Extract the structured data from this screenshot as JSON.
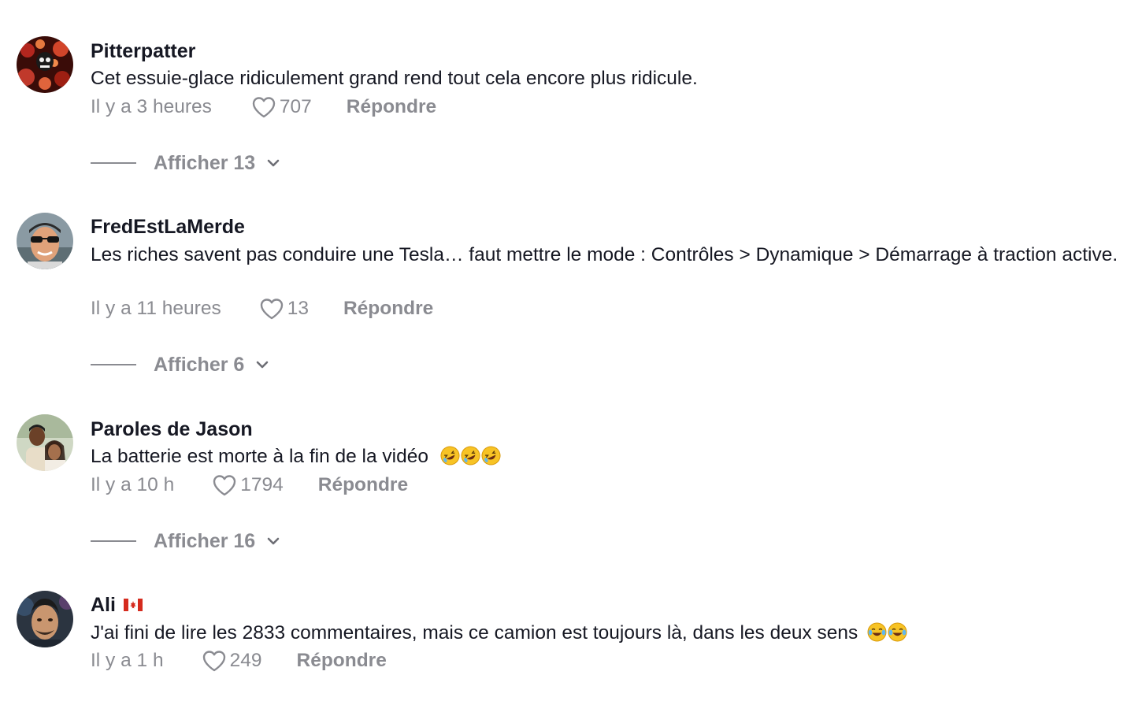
{
  "comments": [
    {
      "username": "Pitterpatter",
      "text": "Cet essuie-glace ridiculement grand rend tout cela encore plus ridicule.",
      "time": "Il y a 3 heures",
      "likes": "707",
      "reply_label": "Répondre",
      "view_replies": "Afficher 13"
    },
    {
      "username": "FredEstLaMerde",
      "text": "Les riches savent pas conduire une Tesla… faut mettre le mode : Contrôles > Dynamique > Démarrage à traction active.",
      "time": "Il y a 11 heures",
      "likes": "13",
      "reply_label": "Répondre",
      "view_replies": "Afficher 6"
    },
    {
      "username": "Paroles de Jason",
      "text": "La batterie est morte à la fin de la vidéo",
      "emoji": [
        "rolling-on-floor-laughing-emoji",
        "rolling-on-floor-laughing-emoji",
        "rolling-on-floor-laughing-emoji"
      ],
      "time": "Il y a 10 h",
      "likes": "1794",
      "reply_label": "Répondre",
      "view_replies": "Afficher 16"
    },
    {
      "username": "Ali",
      "flag": "canada-flag-icon",
      "text": "J'ai fini de lire les 2833 commentaires, mais ce camion est toujours là, dans les deux sens",
      "emoji": [
        "tears-of-joy-emoji",
        "tears-of-joy-emoji"
      ],
      "time": "Il y a 1 h",
      "likes": "249",
      "reply_label": "Répondre"
    }
  ],
  "icons": {
    "like": "heart-outline-icon",
    "expand": "chevron-down-icon"
  },
  "colors": {
    "text": "#161823",
    "secondary": "#8a8b91",
    "background": "#ffffff"
  }
}
